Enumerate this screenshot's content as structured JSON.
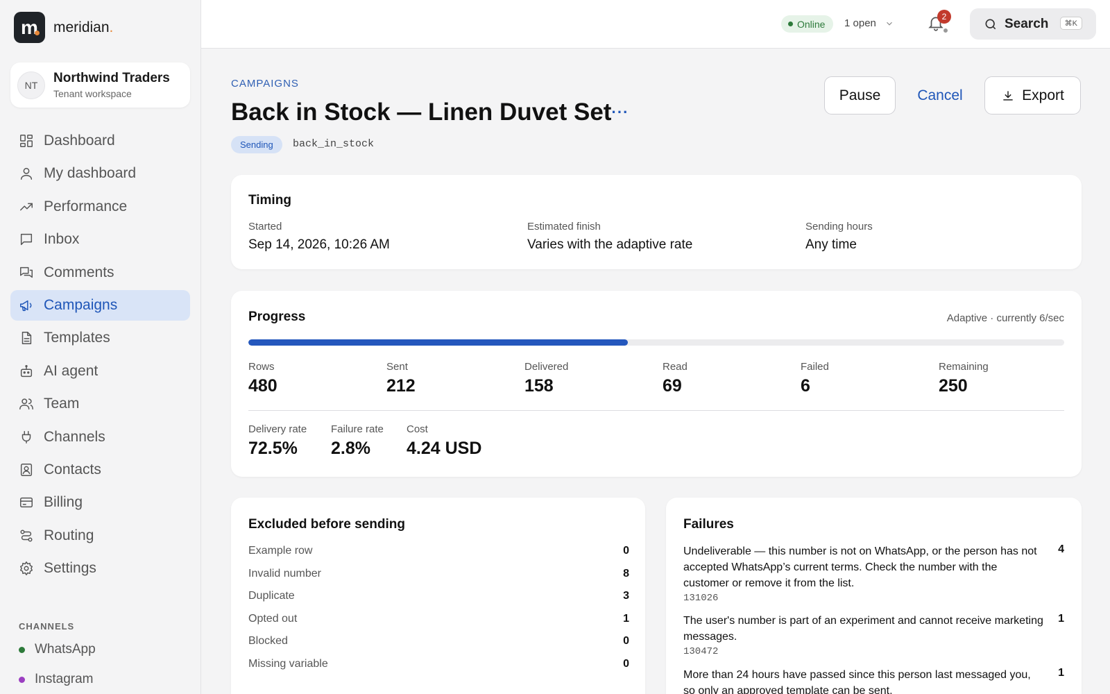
{
  "brand": {
    "name": "meridian",
    "mark": "m",
    "dot": "."
  },
  "tenant": {
    "initials": "NT",
    "name": "Northwind Traders",
    "subtitle": "Tenant workspace"
  },
  "nav": [
    {
      "label": "Dashboard",
      "icon": "dashboard-icon"
    },
    {
      "label": "My dashboard",
      "icon": "user-icon"
    },
    {
      "label": "Performance",
      "icon": "trend-icon"
    },
    {
      "label": "Inbox",
      "icon": "inbox-icon"
    },
    {
      "label": "Comments",
      "icon": "comments-icon"
    },
    {
      "label": "Campaigns",
      "icon": "megaphone-icon",
      "active": true
    },
    {
      "label": "Templates",
      "icon": "document-icon"
    },
    {
      "label": "AI agent",
      "icon": "robot-icon"
    },
    {
      "label": "Team",
      "icon": "team-icon"
    },
    {
      "label": "Channels",
      "icon": "plug-icon"
    },
    {
      "label": "Contacts",
      "icon": "contact-card-icon"
    },
    {
      "label": "Billing",
      "icon": "credit-card-icon"
    },
    {
      "label": "Routing",
      "icon": "routing-icon"
    },
    {
      "label": "Settings",
      "icon": "gear-icon"
    }
  ],
  "channels": {
    "title": "CHANNELS",
    "items": [
      {
        "label": "WhatsApp",
        "color": "#2d7a3a"
      },
      {
        "label": "Instagram",
        "color": "#9b3fc1"
      }
    ]
  },
  "topbar": {
    "online": "Online",
    "open": "1 open",
    "notifications": "2",
    "search": "Search",
    "shortcut": "⌘K"
  },
  "page": {
    "breadcrumb": "CAMPAIGNS",
    "title": "Back in Stock — Linen Duvet Set",
    "more": "···",
    "status": "Sending",
    "slug": "back_in_stock",
    "actions": {
      "pause": "Pause",
      "cancel": "Cancel",
      "export": "Export"
    }
  },
  "timing": {
    "title": "Timing",
    "started_label": "Started",
    "started": "Sep 14, 2026, 10:26 AM",
    "finish_label": "Estimated finish",
    "finish": "Varies with the adaptive rate",
    "hours_label": "Sending hours",
    "hours": "Any time"
  },
  "progress": {
    "title": "Progress",
    "rate": "Adaptive · currently 6/sec",
    "fraction": 0.4655,
    "stats": [
      {
        "label": "Rows",
        "value": "480"
      },
      {
        "label": "Sent",
        "value": "212"
      },
      {
        "label": "Delivered",
        "value": "158"
      },
      {
        "label": "Read",
        "value": "69"
      },
      {
        "label": "Failed",
        "value": "6"
      },
      {
        "label": "Remaining",
        "value": "250"
      }
    ],
    "metrics": [
      {
        "label": "Delivery rate",
        "value": "72.5%"
      },
      {
        "label": "Failure rate",
        "value": "2.8%"
      },
      {
        "label": "Cost",
        "value": "4.24 USD"
      }
    ]
  },
  "excluded": {
    "title": "Excluded before sending",
    "rows": [
      {
        "label": "Example row",
        "value": "0"
      },
      {
        "label": "Invalid number",
        "value": "8"
      },
      {
        "label": "Duplicate",
        "value": "3"
      },
      {
        "label": "Opted out",
        "value": "1"
      },
      {
        "label": "Blocked",
        "value": "0"
      },
      {
        "label": "Missing variable",
        "value": "0"
      }
    ]
  },
  "failures": {
    "title": "Failures",
    "items": [
      {
        "text": "Undeliverable — this number is not on WhatsApp, or the person has not accepted WhatsApp’s current terms. Check the number with the customer or remove it from the list.",
        "code": "131026",
        "count": "4"
      },
      {
        "text": "The user's number is part of an experiment and cannot receive marketing messages.",
        "code": "130472",
        "count": "1"
      },
      {
        "text": "More than 24 hours have passed since this person last messaged you, so only an approved template can be sent.",
        "code": "",
        "count": "1"
      }
    ]
  }
}
